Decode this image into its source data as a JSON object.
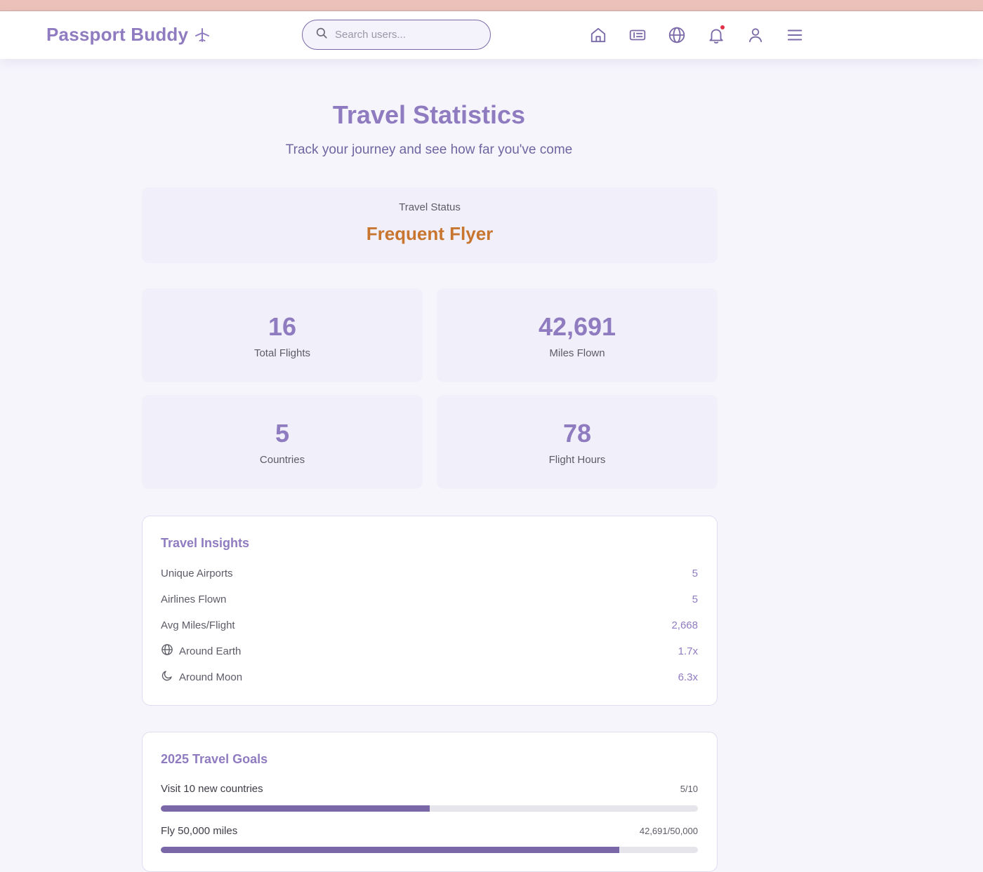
{
  "brand": {
    "name": "Passport Buddy",
    "icon": "plane-icon"
  },
  "search": {
    "placeholder": "Search users..."
  },
  "nav": {
    "icons": [
      "home-icon",
      "id-card-icon",
      "globe-icon",
      "bell-icon",
      "user-icon",
      "menu-icon"
    ],
    "notification_dot_color": "#e0334a"
  },
  "page": {
    "title": "Travel Statistics",
    "subtitle": "Track your journey and see how far you've come"
  },
  "status": {
    "label": "Travel Status",
    "value": "Frequent Flyer"
  },
  "stats": [
    {
      "value": "16",
      "label": "Total Flights"
    },
    {
      "value": "42,691",
      "label": "Miles Flown"
    },
    {
      "value": "5",
      "label": "Countries"
    },
    {
      "value": "78",
      "label": "Flight Hours"
    }
  ],
  "insights": {
    "title": "Travel Insights",
    "rows": [
      {
        "label": "Unique Airports",
        "value": "5"
      },
      {
        "label": "Airlines Flown",
        "value": "5"
      },
      {
        "label": "Avg Miles/Flight",
        "value": "2,668"
      },
      {
        "label": "Around Earth",
        "value": "1.7x",
        "icon": "globe-icon"
      },
      {
        "label": "Around Moon",
        "value": "6.3x",
        "icon": "moon-icon"
      }
    ]
  },
  "goals": {
    "title": "2025 Travel Goals",
    "items": [
      {
        "label": "Visit 10 new countries",
        "count": "5/10",
        "progress": 0.5
      },
      {
        "label": "Fly 50,000 miles",
        "count": "42,691/50,000",
        "progress": 0.8538
      }
    ]
  },
  "colors": {
    "accent": "#8f7bbf",
    "status": "#c8752f",
    "progress": "#7a67a8",
    "card_bg": "#f1f0fa",
    "top_strip": "#ecc1b9"
  }
}
